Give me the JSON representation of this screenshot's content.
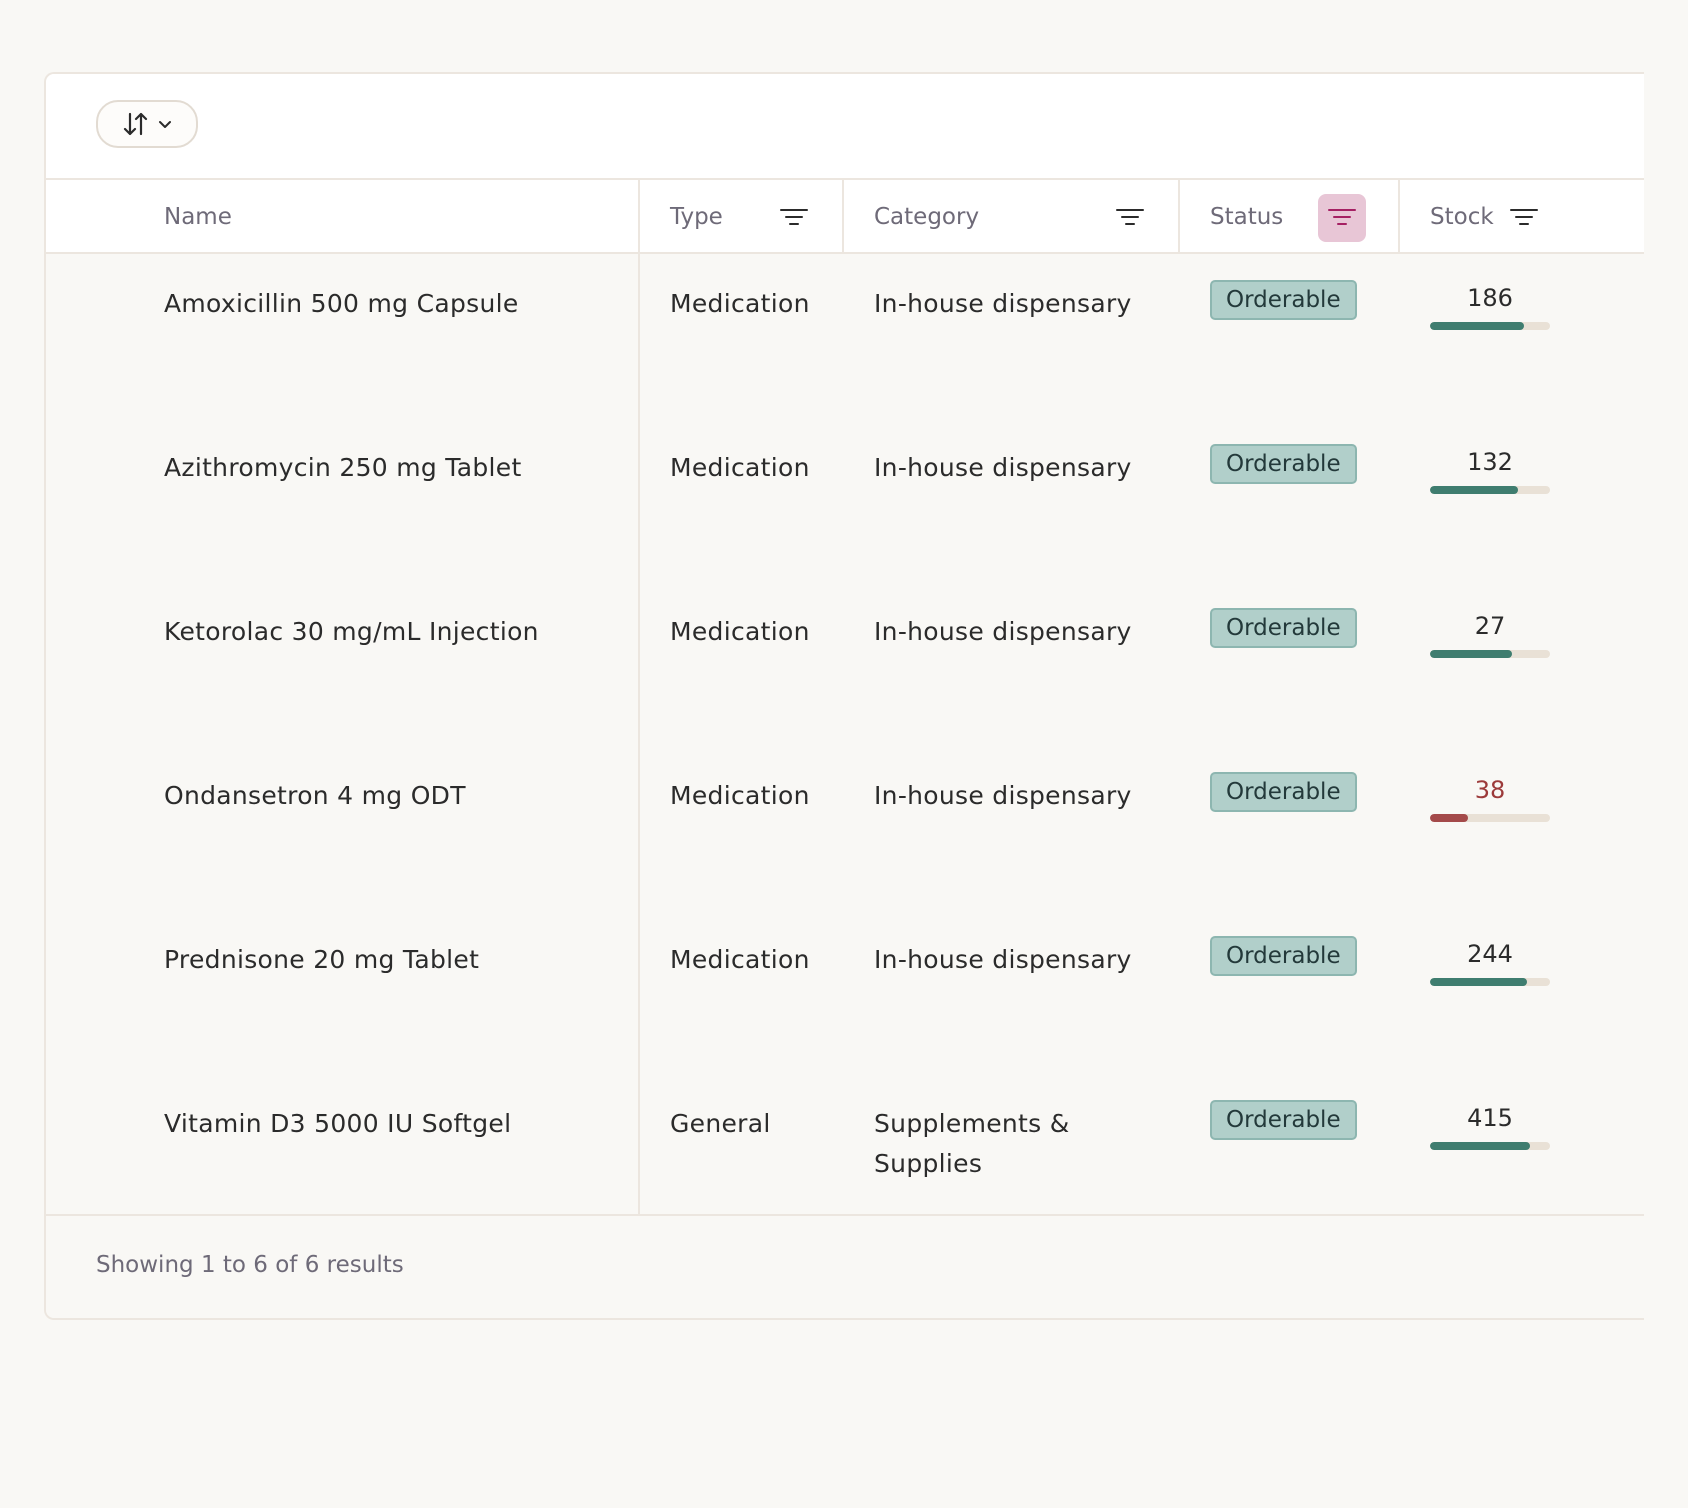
{
  "toolbar": {
    "sort_button": {
      "icon": "sort-arrows-icon",
      "chevron": "chevron-down-icon"
    }
  },
  "table": {
    "headers": [
      {
        "label": "Name",
        "filter": false
      },
      {
        "label": "Type",
        "filter": true,
        "active": false
      },
      {
        "label": "Category",
        "filter": true,
        "active": false
      },
      {
        "label": "Status",
        "filter": true,
        "active": true
      },
      {
        "label": "Stock",
        "filter": true,
        "active": false
      }
    ],
    "rows": [
      {
        "name": "Amoxicillin 500 mg Capsule",
        "type": "Medication",
        "category": "In-house dispensary",
        "status": "Orderable",
        "stock": "186",
        "stock_level": 0.78,
        "low": false
      },
      {
        "name": "Azithromycin 250 mg Tablet",
        "type": "Medication",
        "category": "In-house dispensary",
        "status": "Orderable",
        "stock": "132",
        "stock_level": 0.73,
        "low": false
      },
      {
        "name": "Ketorolac 30 mg/mL Injection",
        "type": "Medication",
        "category": "In-house dispensary",
        "status": "Orderable",
        "stock": "27",
        "stock_level": 0.68,
        "low": false
      },
      {
        "name": "Ondansetron 4 mg ODT",
        "type": "Medication",
        "category": "In-house dispensary",
        "status": "Orderable",
        "stock": "38",
        "stock_level": 0.32,
        "low": true
      },
      {
        "name": "Prednisone 20 mg Tablet",
        "type": "Medication",
        "category": "In-house dispensary",
        "status": "Orderable",
        "stock": "244",
        "stock_level": 0.81,
        "low": false
      },
      {
        "name": "Vitamin D3 5000 IU Softgel",
        "type": "General",
        "category": "Supplements & Supplies",
        "status": "Orderable",
        "stock": "415",
        "stock_level": 0.83,
        "low": false
      }
    ]
  },
  "footer": {
    "summary": "Showing 1 to 6 of 6 results"
  },
  "colors": {
    "accent_green": "#3f7d6f",
    "low_red": "#a44a4a",
    "badge_bg": "#b1cfca",
    "active_filter_bg": "#e8c6d6"
  }
}
